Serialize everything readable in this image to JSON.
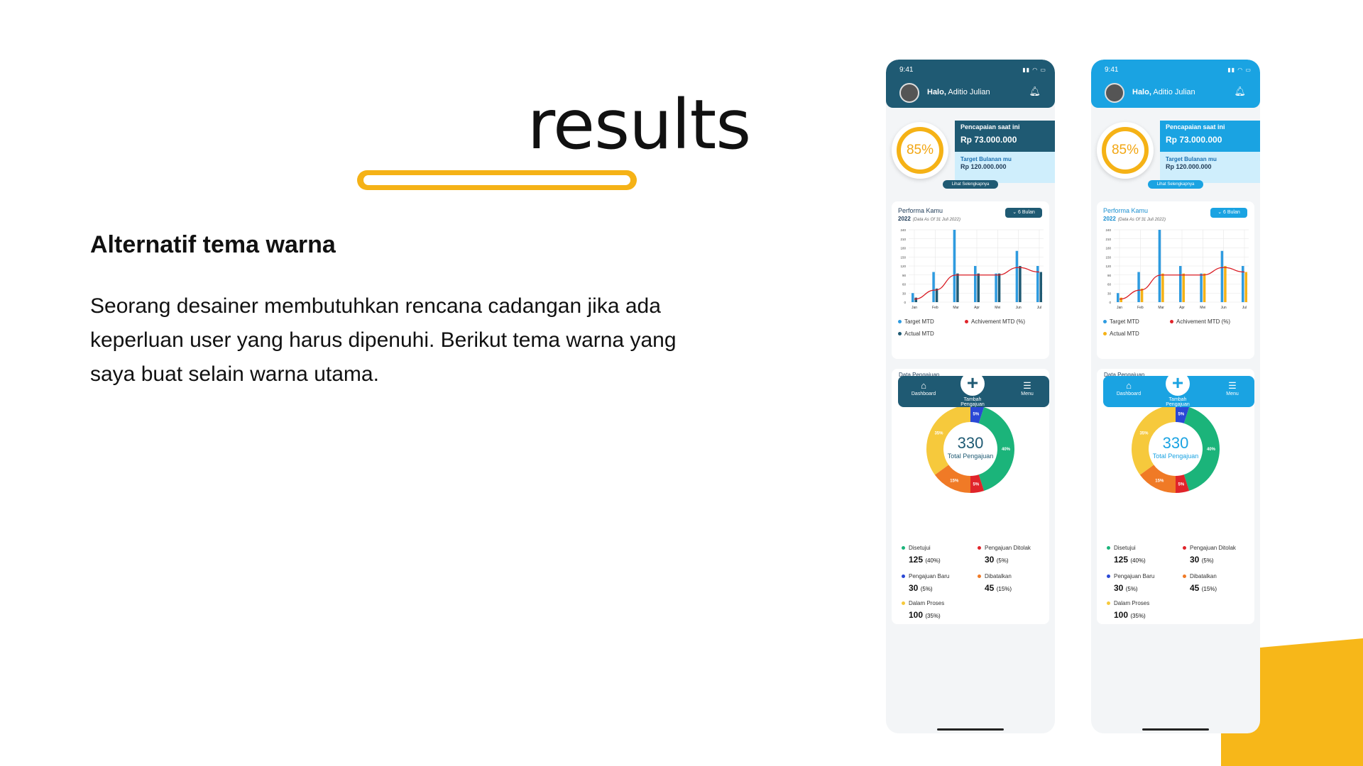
{
  "slide": {
    "title": "results",
    "subheading": "Alternatif tema warna",
    "body": "Seorang desainer membutuhkan rencana cadangan jika ada keperluan user yang harus dipenuhi. Berikut tema warna yang saya buat selain warna utama."
  },
  "app": {
    "status_time": "9:41",
    "greeting_bold": "Halo,",
    "greeting_name": " Aditio Julian",
    "progress_percent": "85%",
    "achievement_label": "Pencapaian saat ini",
    "achievement_value": "Rp 73.000.000",
    "target_label": "Target Bulanan mu",
    "target_value": "Rp 120.000.000",
    "see_more": "Lihat Selengkapnya",
    "performance_title": "Performa Kamu",
    "performance_year": "2022",
    "performance_note": "(Data As Of 31 Juli 2022)",
    "period_button": "6 Bulan",
    "legend": {
      "target": "Target MTD",
      "achievement": "Achivement MTD (%)",
      "actual": "Actual MTD"
    },
    "card_peek": "Data Pengajuan",
    "donut_total": "330",
    "donut_label": "Total Pengajuan",
    "stats": [
      {
        "label": "Disetujui",
        "value": "125",
        "pct": "(40%)",
        "color": "#1bb47a"
      },
      {
        "label": "Pengajuan Ditolak",
        "value": "30",
        "pct": "(5%)",
        "color": "#e0242a"
      },
      {
        "label": "Pengajuan Baru",
        "value": "30",
        "pct": "(5%)",
        "color": "#2a48d6"
      },
      {
        "label": "Dibatalkan",
        "value": "45",
        "pct": "(15%)",
        "color": "#f07a26"
      },
      {
        "label": "Dalam Proses",
        "value": "100",
        "pct": "(35%)",
        "color": "#f6c93c"
      }
    ],
    "nav": {
      "dashboard": "Dashboard",
      "add": "Tambah Pengajuan",
      "menu": "Menu"
    }
  },
  "themes": {
    "primary": "#1f5a73",
    "alternative": "#1aa3e2",
    "accent": "#f5b216"
  },
  "chart_data": {
    "type": "bar",
    "categories": [
      "Jan",
      "Feb",
      "Mar",
      "Apr",
      "Mei",
      "Jun",
      "Jul"
    ],
    "series": [
      {
        "name": "Target MTD",
        "values": [
          30,
          100,
          240,
          120,
          95,
          170,
          120
        ]
      },
      {
        "name": "Actual MTD",
        "values": [
          15,
          45,
          95,
          95,
          95,
          120,
          100
        ]
      },
      {
        "name": "Achivement MTD (%)",
        "values": [
          10,
          40,
          90,
          90,
          90,
          115,
          100
        ]
      }
    ],
    "ylim": [
      0,
      240
    ],
    "yticks": [
      0,
      30,
      60,
      90,
      120,
      150,
      180,
      210,
      240
    ]
  },
  "donut_data": {
    "type": "pie",
    "labels": [
      "Pengajuan Baru",
      "Disetujui",
      "Pengajuan Ditolak",
      "Dibatalkan",
      "Dalam Proses"
    ],
    "values": [
      5,
      40,
      5,
      15,
      35
    ],
    "slice_labels": [
      "5%",
      "40%",
      "5%",
      "15%",
      "35%"
    ],
    "colors": [
      "#2a48d6",
      "#1bb47a",
      "#e0242a",
      "#f07a26",
      "#f6c93c"
    ]
  }
}
